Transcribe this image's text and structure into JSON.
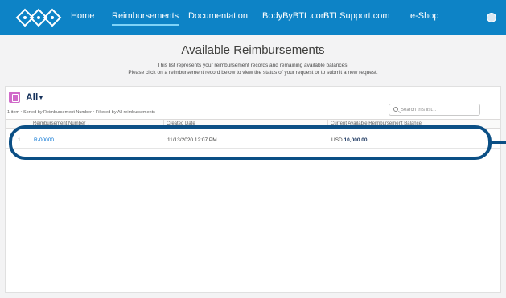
{
  "nav": {
    "items": [
      "Home",
      "Reimbursements",
      "Documentation",
      "BodyByBTL.com",
      "BTLSupport.com",
      "e-Shop"
    ],
    "active": "Reimbursements",
    "bg_color": "#0d83c6",
    "avatar_icon": "user-avatar-icon",
    "logo_icon": "btl-logo-icon"
  },
  "header": {
    "title": "Available Reimbursements",
    "intro_line1": "This list represents your reimbursement records and remaining available balances.",
    "intro_line2": "Please click on a reimbursement record below to view the status of your request or to submit a new request."
  },
  "list": {
    "name": "All",
    "icon": "list-view-icon",
    "meta": "1 item • Sorted by Reimbursement Number • Filtered by All reimbursements",
    "search_placeholder": "Search this list...",
    "columns": [
      "Reimbursement Number ↓",
      "Created Date",
      "Current Available Reimbursement Balance"
    ],
    "rows": [
      {
        "index": "1",
        "number": "R-00000",
        "created": "11/13/2020 12:07 PM",
        "currency": "USD",
        "balance": "10,000.00"
      }
    ]
  },
  "highlight_color": "#0b4f85"
}
